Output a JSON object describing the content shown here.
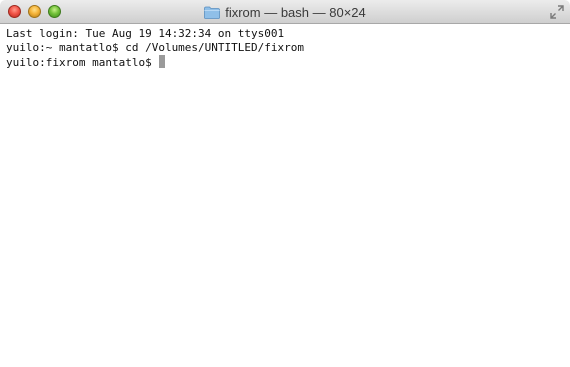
{
  "window": {
    "title": "fixrom — bash — 80×24",
    "title_icon": "folder-icon",
    "buttons": {
      "close": "close-button",
      "minimize": "minimize-button",
      "zoom": "zoom-button",
      "fullscreen": "fullscreen-button"
    }
  },
  "terminal": {
    "lines": [
      "Last login: Tue Aug 19 14:32:34 on ttys001",
      "yuilo:~ mantatlo$ cd /Volumes/UNTITLED/fixrom",
      "yuilo:fixrom mantatlo$ "
    ]
  },
  "colors": {
    "background": "#ffffff",
    "text": "#111111",
    "cursor": "#9a9a9a",
    "close": "#f2564a",
    "minimize": "#f5b43a",
    "zoom": "#74c23a"
  }
}
